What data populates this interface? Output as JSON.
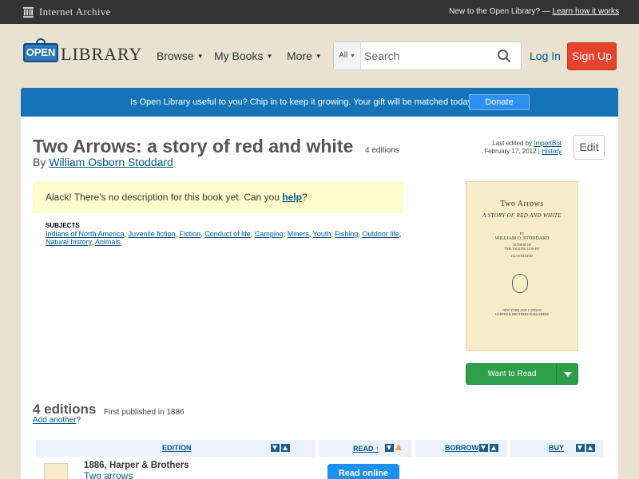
{
  "topbar": {
    "ia_name": "Internet Archive",
    "new_text": "New to the Open Library? —",
    "learn_link": "Learn how it works"
  },
  "header": {
    "logo_sign": "OPEN",
    "logo_word": "LIBRARY",
    "nav": [
      "Browse",
      "My Books",
      "More"
    ],
    "search_scope": "All",
    "search_placeholder": "Search",
    "login": "Log In",
    "signup": "Sign Up"
  },
  "donate": {
    "message": "Is Open Library useful to you? Chip in to keep it growing. Your gift will be matched today!",
    "button": "Donate"
  },
  "book": {
    "title": "Two Arrows: a story of red and white",
    "editions_count": "4 editions",
    "by": "By",
    "author": "William Osborn Stoddard",
    "last_edited_prefix": "Last edited by",
    "last_edited_user": "ImportBot",
    "last_edited_date": "February 17, 2012",
    "separator": "|",
    "history": "History",
    "edit": "Edit",
    "desc_text": "Alack! There's no description for this book yet. Can you",
    "desc_link": "help",
    "desc_end": "?",
    "subjects_label": "SUBJECTS",
    "subjects": [
      "Indians of North America",
      "Juvenile fiction",
      "Fiction",
      "Conduct of life",
      "Camping",
      "Miners",
      "Youth",
      "Fishing",
      "Outdoor life",
      "Natural history",
      "Animals"
    ],
    "want_to_read": "Want to Read"
  },
  "cover": {
    "title": "Two Arrows",
    "subtitle": "A STORY OF RED AND WHITE",
    "by": "BY",
    "author": "WILLIAM O. STODDARD",
    "author_note_1": "AUTHOR OF",
    "author_note_2": "\"THE TALKING LEAVES\"",
    "illustrated": "ILLUSTRATED",
    "publisher_1": "NEW YORK AND LONDON",
    "publisher_2": "HARPER & BROTHERS PUBLISHERS"
  },
  "editions": {
    "heading": "4 editions",
    "first_published": "First published in 1886",
    "add_link": "Add another",
    "add_end": "?",
    "columns": {
      "edition": "EDITION",
      "read": "READ ↑",
      "borrow": "BORROW",
      "buy": "BUY"
    },
    "rows": [
      {
        "publisher": "1886, Harper & Brothers",
        "title": "Two arrows",
        "action": "Read online"
      }
    ]
  },
  "colors": {
    "topbar": "#333333",
    "page_bg": "#e9e2d0",
    "donate_bar": "#1574b8",
    "signup": "#e5432b",
    "want_to_read": "#2e9e4a",
    "link": "#02598b"
  }
}
